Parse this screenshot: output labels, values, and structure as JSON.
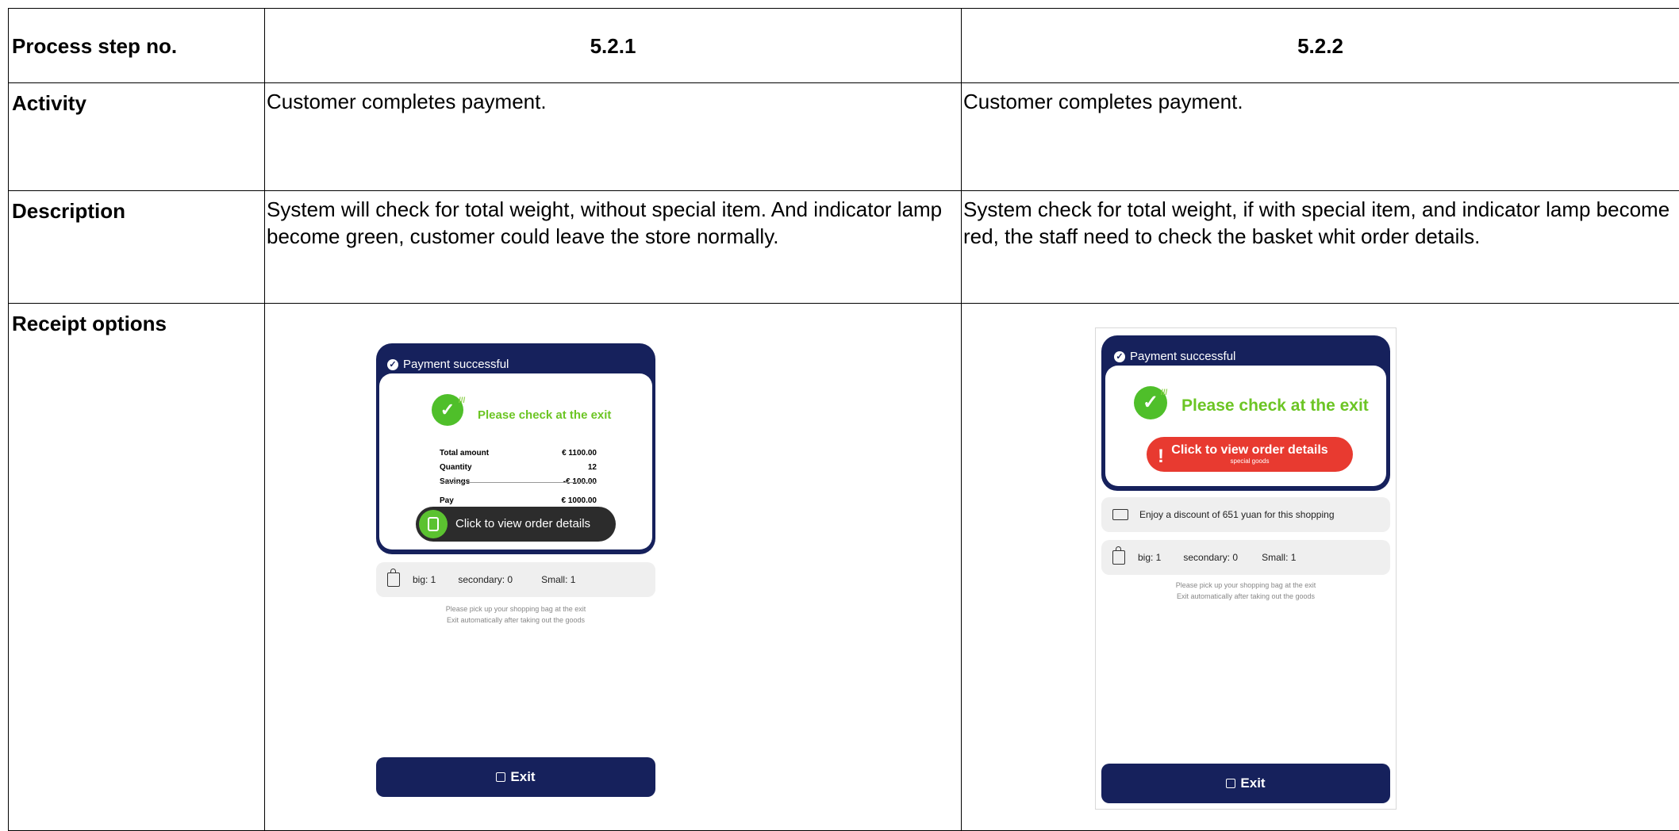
{
  "table": {
    "rows": {
      "process_step": "Process step no.",
      "activity": "Activity",
      "description": "Description",
      "receipt": "Receipt options"
    },
    "col1": {
      "step": "5.2.1",
      "activity": "Customer completes payment.",
      "description": "System will check for total weight, without special item. And indicator lamp become green, customer could leave the store normally."
    },
    "col2": {
      "step": "5.2.2",
      "activity": "Customer completes payment.",
      "description": "System check for total weight, if with special item, and indicator lamp become red, the staff need to check the basket whit order details."
    }
  },
  "screen1": {
    "header": "Payment successful",
    "check_title": "Please check at the exit",
    "summary": [
      {
        "label": "Total amount",
        "value": "€ 1100.00"
      },
      {
        "label": "Quantity",
        "value": "12"
      },
      {
        "label": "Savings",
        "value": "-€ 100.00"
      },
      {
        "label": "Pay",
        "value": "€ 1000.00"
      }
    ],
    "order_button": "Click to view order details",
    "bag": {
      "big": "big: 1",
      "secondary": "secondary: 0",
      "small": "Small: 1"
    },
    "note1": "Please pick up your shopping bag at the exit",
    "note2": "Exit automatically after taking out the goods",
    "exit": "Exit"
  },
  "screen2": {
    "header": "Payment successful",
    "check_title": "Please check at the exit",
    "order_button": "Click to view order details",
    "order_sub": "special goods",
    "discount": "Enjoy a discount of 651 yuan for this shopping",
    "bag": {
      "big": "big: 1",
      "secondary": "secondary: 0",
      "small": "Small: 1"
    },
    "note1": "Please pick up your shopping bag at the exit",
    "note2": "Exit automatically after taking out the goods",
    "exit": "Exit"
  },
  "colors": {
    "navy": "#16215c",
    "green": "#6cc524",
    "red": "#e83a30"
  },
  "icons": [
    "check-circle-icon",
    "clipboard-icon",
    "shopping-bag-icon",
    "ticket-icon",
    "exit-icon",
    "exclamation-icon"
  ]
}
